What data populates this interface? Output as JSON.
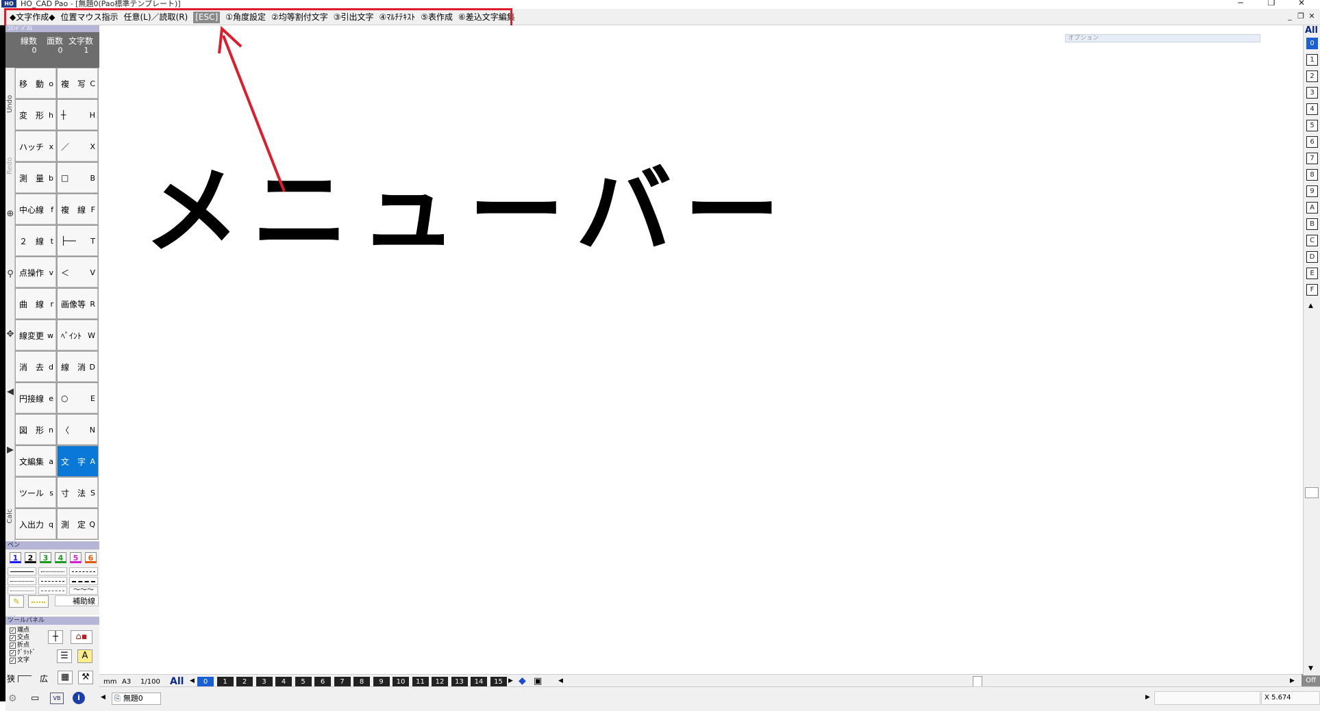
{
  "window": {
    "logo": "HO",
    "title": "HO_CAD Pao - [無題0(Pao標準テンプレート)]",
    "controls": [
      "─",
      "❐",
      "✕"
    ],
    "mdi_controls": [
      "_",
      "❐",
      "✕"
    ]
  },
  "menu": {
    "items": [
      "◆文字作成◆",
      "位置マウス指示",
      "任意(L)／読取(R)",
      "[ESC]",
      "①角度設定",
      "②均等割付文字",
      "③引出文字",
      "④ﾏﾙﾁﾃｷｽﾄ",
      "⑤表作成",
      "⑥差込文字編集"
    ]
  },
  "annotation": {
    "text": "メニューバー",
    "arrow_color": "#e01c2b",
    "highlight_color": "#e01c2b"
  },
  "command_panel": {
    "header": "ｺﾏﾝﾄﾞﾊﾟﾈﾙ",
    "counts_labels": [
      "線数",
      "面数",
      "文字数"
    ],
    "counts_values": [
      "0",
      "0",
      "1"
    ],
    "buttons": [
      {
        "label": "移　動",
        "key": "o"
      },
      {
        "label": "複　写",
        "key": "C"
      },
      {
        "label": "変　形",
        "key": "h"
      },
      {
        "label": "┼",
        "key": "H"
      },
      {
        "label": "ハッチ",
        "key": "x"
      },
      {
        "label": "／",
        "key": "X"
      },
      {
        "label": "測　量",
        "key": "b"
      },
      {
        "label": "□",
        "key": "B"
      },
      {
        "label": "中心線",
        "key": "f"
      },
      {
        "label": "複　線",
        "key": "F"
      },
      {
        "label": "２　線",
        "key": "t"
      },
      {
        "label": "├──",
        "key": "T"
      },
      {
        "label": "点操作",
        "key": "v"
      },
      {
        "label": "＜",
        "key": "V"
      },
      {
        "label": "曲　線",
        "key": "r"
      },
      {
        "label": "画像等",
        "key": "R"
      },
      {
        "label": "線変更",
        "key": "w"
      },
      {
        "label": "ﾍﾟｲﾝﾄ",
        "key": "W"
      },
      {
        "label": "消　去",
        "key": "d"
      },
      {
        "label": "線　消",
        "key": "D"
      },
      {
        "label": "円接線",
        "key": "e"
      },
      {
        "label": "○",
        "key": "E"
      },
      {
        "label": "図　形",
        "key": "n"
      },
      {
        "label": "〈",
        "key": "N"
      },
      {
        "label": "文編集",
        "key": "a"
      },
      {
        "label": "文　字",
        "key": "A"
      },
      {
        "label": "ツール",
        "key": "s"
      },
      {
        "label": "寸　法",
        "key": "S"
      },
      {
        "label": "入出力",
        "key": "q"
      },
      {
        "label": "測　定",
        "key": "Q"
      }
    ],
    "active_index": 25
  },
  "side_labels": {
    "undo": "Undo",
    "redo": "Redo",
    "calc": "Calc"
  },
  "pen_panel": {
    "header": "ペン",
    "numbers": [
      "1",
      "2",
      "3",
      "4",
      "5",
      "6"
    ],
    "colors": [
      "#1a1aff",
      "#000000",
      "#1a9a1a",
      "#1a9a1a",
      "#d81ad8",
      "#e05a00"
    ],
    "aux_line": "補助線"
  },
  "tool_panel": {
    "header": "ツールパネル",
    "checks": [
      "端点",
      "交点",
      "折点",
      "ｸﾞﾘｯﾄﾞ",
      "文字"
    ],
    "narrow": "狭",
    "wide": "広"
  },
  "sheet_bar": {
    "unit": "mm",
    "paper": "A3",
    "scale": "1/100",
    "all": "All",
    "sheets": [
      "0",
      "1",
      "2",
      "3",
      "4",
      "5",
      "6",
      "7",
      "8",
      "9",
      "10",
      "11",
      "12",
      "13",
      "14",
      "15"
    ],
    "current_sheet": "0",
    "off": "Off"
  },
  "layer_column": {
    "all": "All",
    "layers": [
      "0",
      "1",
      "2",
      "3",
      "4",
      "5",
      "6",
      "7",
      "8",
      "9",
      "A",
      "B",
      "C",
      "D",
      "E",
      "F"
    ],
    "current_layer": "0"
  },
  "option_box": {
    "label": "オプション"
  },
  "statusbar": {
    "doc_tab": "無題0",
    "coordinate": "X  5.674"
  }
}
